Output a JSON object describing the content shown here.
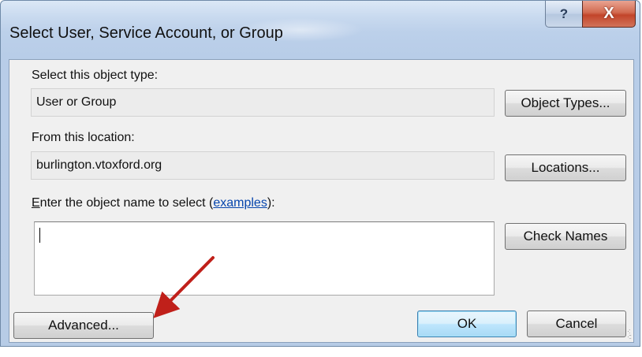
{
  "window": {
    "title": "Select User, Service Account, or Group",
    "help_glyph": "?",
    "close_glyph": "X"
  },
  "object_type": {
    "label": "Select this object type:",
    "value": "User or Group",
    "button": "Object Types..."
  },
  "location": {
    "label": "From this location:",
    "value": "burlington.vtoxford.org",
    "button": "Locations..."
  },
  "names": {
    "label_access_key": "E",
    "label_prefix": "nter the object name to select (",
    "label_link": "examples",
    "label_suffix": "):",
    "input_value": "",
    "button": "Check Names"
  },
  "footer": {
    "advanced": "Advanced...",
    "ok": "OK",
    "cancel": "Cancel"
  },
  "colors": {
    "annotation_arrow": "#c0201a"
  },
  "icons": [
    "help-icon",
    "close-icon",
    "resize-grip-icon",
    "annotation-arrow"
  ]
}
